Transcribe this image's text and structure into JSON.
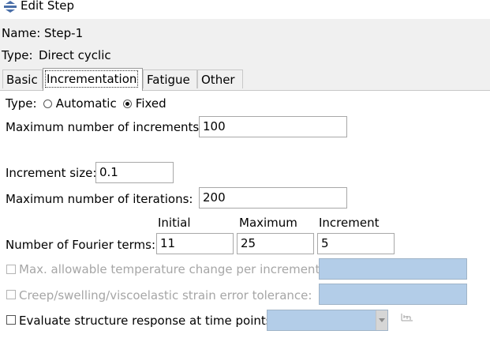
{
  "window": {
    "title": "Edit Step",
    "icon": "step-icon"
  },
  "step": {
    "name_label": "Name:",
    "name_value": "Step-1",
    "type_label": "Type:",
    "type_value": "Direct cyclic"
  },
  "tabs": [
    {
      "label": "Basic"
    },
    {
      "label": "Incrementation"
    },
    {
      "label": "Fatigue"
    },
    {
      "label": "Other"
    }
  ],
  "active_tab": "Incrementation",
  "incrementation": {
    "type_label": "Type:",
    "type_options": [
      "Automatic",
      "Fixed"
    ],
    "type_selected": "Fixed",
    "max_increments_label": "Maximum number of increments:",
    "max_increments_value": "100",
    "increment_size_label": "Increment size:",
    "increment_size_value": "0.1",
    "max_iterations_label": "Maximum number of iterations:",
    "max_iterations_value": "200",
    "fourier_columns": [
      "Initial",
      "Maximum",
      "Increment"
    ],
    "fourier_label": "Number of Fourier terms:",
    "fourier_initial": "11",
    "fourier_maximum": "25",
    "fourier_increment": "5",
    "max_temp_change_label": "Max. allowable temperature change per  increment:",
    "max_temp_change_value": "",
    "creep_tolerance_label": "Creep/swelling/viscoelastic strain error tolerance:",
    "creep_tolerance_value": "",
    "evaluate_label": "Evaluate structure response at time points:",
    "evaluate_checked": false,
    "time_points_value": ""
  },
  "colors": {
    "disabled_field": "#b3cde8",
    "panel": "#f0f0f0"
  }
}
